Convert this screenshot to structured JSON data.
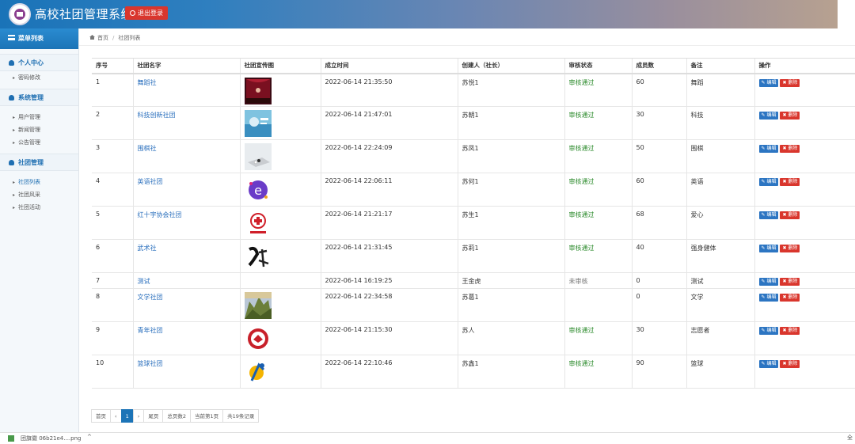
{
  "app": {
    "title": "高校社团管理系统",
    "logout_label": "退出登录"
  },
  "sidebar": {
    "menu_title": "菜单列表",
    "sections": [
      {
        "title": "个人中心",
        "items": [
          "密码修改"
        ]
      },
      {
        "title": "系统管理",
        "items": [
          "用户管理",
          "新闻管理",
          "公告管理"
        ]
      },
      {
        "title": "社团管理",
        "items": [
          "社团列表",
          "社团风采",
          "社团活动"
        ]
      }
    ]
  },
  "breadcrumb": {
    "home": "首页",
    "current": "社团列表"
  },
  "table": {
    "headers": [
      "序号",
      "社团名字",
      "社团宣传图",
      "成立时间",
      "创建人（社长）",
      "审核状态",
      "成员数",
      "备注",
      "操作"
    ],
    "edit_label": "编辑",
    "delete_label": "删除",
    "rows": [
      {
        "id": "1",
        "name": "舞蹈社",
        "time": "2022-06-14 21:35:50",
        "creator": "苏悦1",
        "status": "审核通过",
        "members": "60",
        "note": "舞蹈",
        "image": "dance"
      },
      {
        "id": "2",
        "name": "科技创新社团",
        "time": "2022-06-14 21:47:01",
        "creator": "苏朝1",
        "status": "审核通过",
        "members": "30",
        "note": "科技",
        "image": "tech"
      },
      {
        "id": "3",
        "name": "围棋社",
        "time": "2022-06-14 22:24:09",
        "creator": "苏凤1",
        "status": "审核通过",
        "members": "50",
        "note": "围棋",
        "image": "go"
      },
      {
        "id": "4",
        "name": "英语社团",
        "time": "2022-06-14 22:06:11",
        "creator": "苏何1",
        "status": "审核通过",
        "members": "60",
        "note": "英语",
        "image": "english"
      },
      {
        "id": "5",
        "name": "红十字协会社团",
        "time": "2022-06-14 21:21:17",
        "creator": "苏生1",
        "status": "审核通过",
        "members": "68",
        "note": "爱心",
        "image": "redcross"
      },
      {
        "id": "6",
        "name": "武术社",
        "time": "2022-06-14 21:31:45",
        "creator": "苏莉1",
        "status": "审核通过",
        "members": "40",
        "note": "强身健体",
        "image": "wushu"
      },
      {
        "id": "7",
        "name": "测试",
        "time": "2022-06-14 16:19:25",
        "creator": "王金虎",
        "status": "未审核",
        "members": "0",
        "note": "测试",
        "image": ""
      },
      {
        "id": "8",
        "name": "文学社团",
        "time": "2022-06-14 22:34:58",
        "creator": "苏葛1",
        "status": "",
        "members": "0",
        "note": "文学",
        "image": "literature"
      },
      {
        "id": "9",
        "name": "青年社团",
        "time": "2022-06-14 21:15:30",
        "creator": "苏人",
        "status": "审核通过",
        "members": "30",
        "note": "志愿者",
        "image": "youth"
      },
      {
        "id": "10",
        "name": "篮球社团",
        "time": "2022-06-14 22:10:46",
        "creator": "苏鑫1",
        "status": "审核通过",
        "members": "90",
        "note": "篮球",
        "image": "basketball"
      }
    ]
  },
  "pagination": {
    "first": "首页",
    "prev": "‹",
    "current": "1",
    "next": "›",
    "last": "尾页",
    "total_pages": "总页数2",
    "current_page": "当前第1页",
    "total_records": "共19条记录"
  },
  "download_bar": {
    "file": "团旗徽 06b21e4....png",
    "caret": "^",
    "more": "全"
  }
}
